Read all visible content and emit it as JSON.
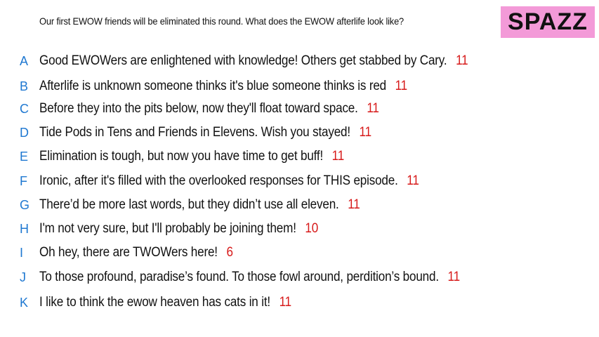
{
  "prompt": "Our first EWOW friends will be eliminated this round. What does the EWOW afterlife look like?",
  "contestant": "SPAZZ",
  "responses": [
    {
      "letter": "A",
      "text": "Good EWOWers are enlightened with knowledge! Others get stabbed by Cary.",
      "count": "11"
    },
    {
      "letter": "B",
      "text": "Afterlife is unknown someone thinks it's blue someone thinks is red",
      "count": "11"
    },
    {
      "letter": "C",
      "text": "Before they into the pits below, now they'll float toward space.",
      "count": "11"
    },
    {
      "letter": "D",
      "text": "Tide Pods in Tens and Friends in Elevens. Wish you stayed!",
      "count": "11"
    },
    {
      "letter": "E",
      "text": "Elimination is tough, but now you have time to get buff!",
      "count": "11"
    },
    {
      "letter": "F",
      "text": "Ironic, after it's filled with the overlooked responses for THIS episode.",
      "count": "11"
    },
    {
      "letter": "G",
      "text": "There’d be more last words, but they didn’t use all eleven.",
      "count": "11"
    },
    {
      "letter": "H",
      "text": "I'm not very sure, but I'll probably be joining them!",
      "count": "10"
    },
    {
      "letter": "I",
      "text": "Oh hey, there are TWOWers here!",
      "count": "6"
    },
    {
      "letter": "J",
      "text": "To those profound, paradise’s found. To those fowl around, perdition’s bound.",
      "count": "11"
    },
    {
      "letter": "K",
      "text": "I like to think the ewow heaven has cats in it!",
      "count": "11"
    }
  ]
}
